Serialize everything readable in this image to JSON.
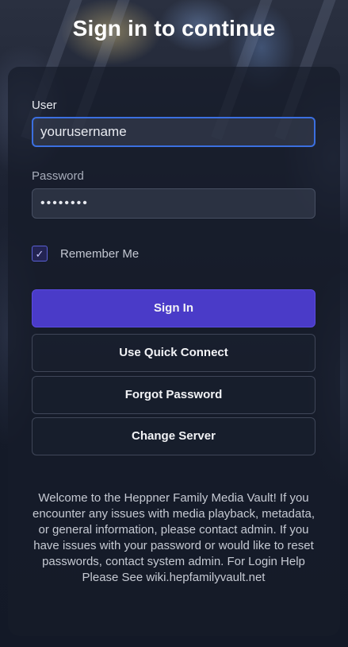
{
  "header": {
    "title": "Sign in to continue"
  },
  "form": {
    "user_label": "User",
    "user_value": "yourusername",
    "password_label": "Password",
    "password_value": "••••••••",
    "remember_checked": true,
    "remember_label": "Remember Me"
  },
  "buttons": {
    "sign_in": "Sign In",
    "quick_connect": "Use Quick Connect",
    "forgot_password": "Forgot Password",
    "change_server": "Change Server"
  },
  "disclaimer": "Welcome to the Heppner Family Media Vault! If you encounter any issues with media playback, metadata, or general information, please contact admin. If you have issues with your password or would like to reset passwords, contact system admin. For Login Help Please See wiki.hepfamilyvault.net",
  "colors": {
    "primary": "#4a3bc8",
    "focus_border": "#3b6fe0",
    "background": "#141a28"
  },
  "icons": {
    "checkmark": "check-icon"
  }
}
